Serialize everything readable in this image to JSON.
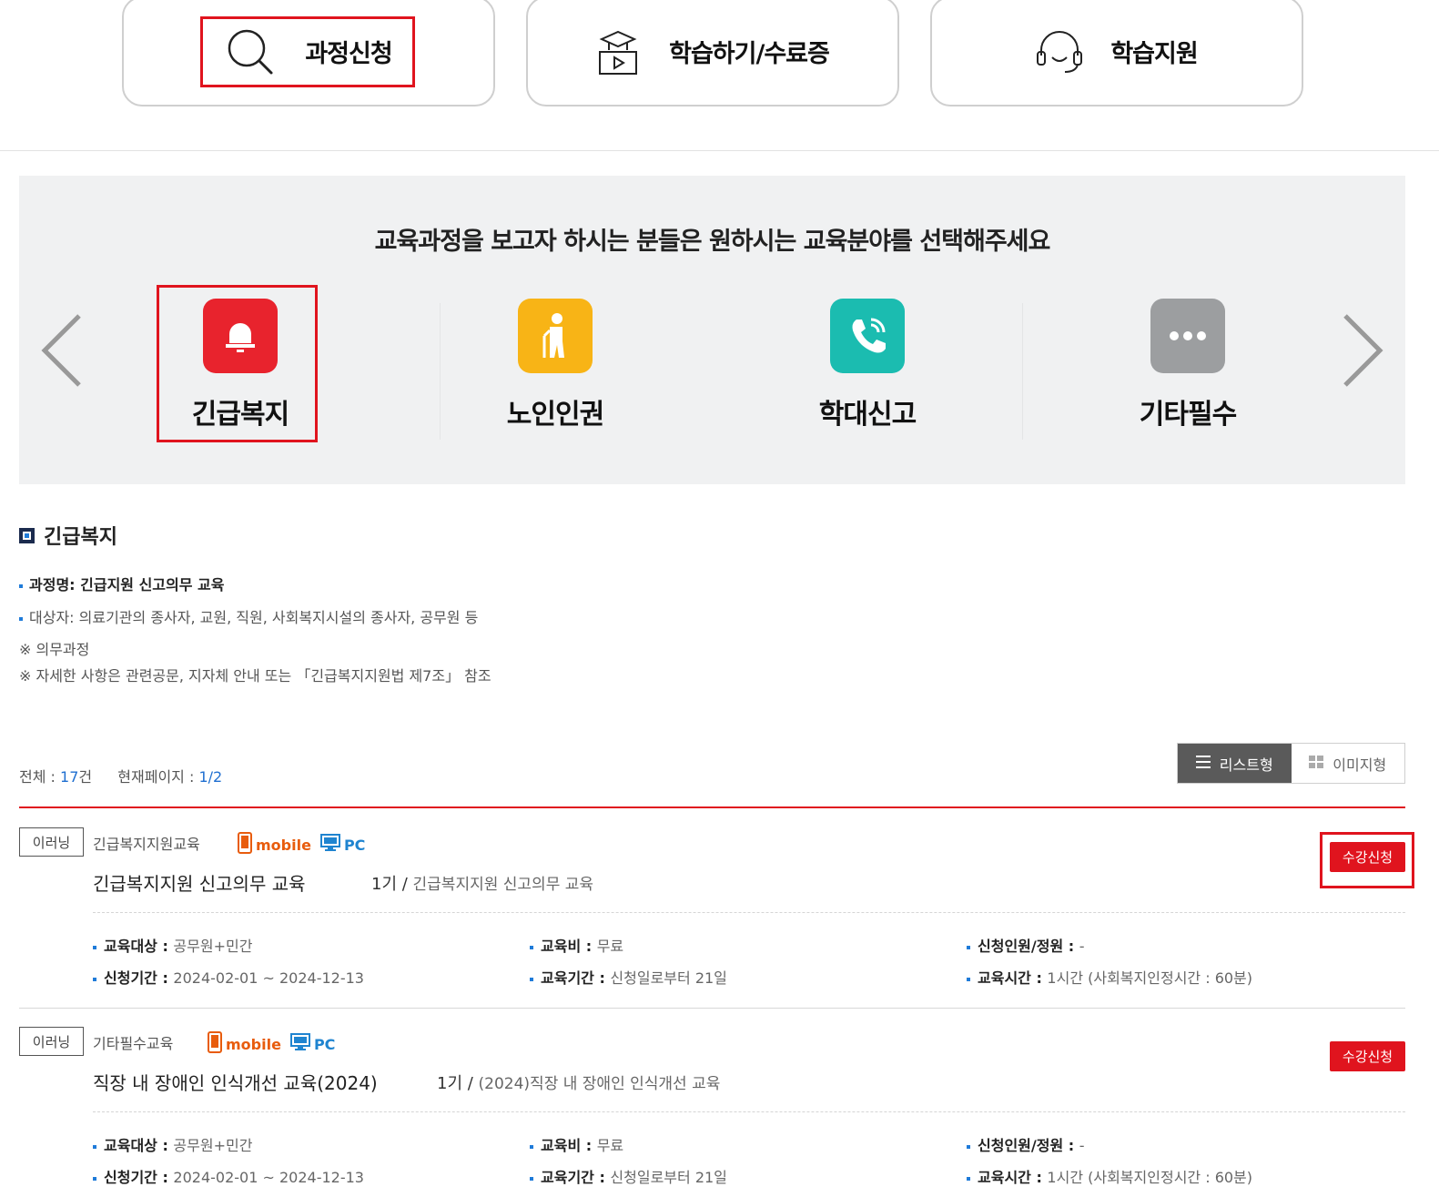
{
  "nav": {
    "items": [
      {
        "label": "과정신청",
        "icon": "search-icon"
      },
      {
        "label": "학습하기/수료증",
        "icon": "study-icon"
      },
      {
        "label": "학습지원",
        "icon": "headset-icon"
      }
    ]
  },
  "category_panel": {
    "title": "교육과정을 보고자 하시는 분들은 원하시는 교육분야를 선택해주세요",
    "items": [
      {
        "label": "긴급복지",
        "icon": "bell-icon",
        "color": "#e8232d"
      },
      {
        "label": "노인인권",
        "icon": "elderly-icon",
        "color": "#f8b416"
      },
      {
        "label": "학대신고",
        "icon": "phone-icon",
        "color": "#1bbcb0"
      },
      {
        "label": "기타필수",
        "icon": "more-icon",
        "color": "#9c9ea0"
      }
    ]
  },
  "section": {
    "title": "긴급복지",
    "course_name": "과정명: 긴급지원 신고의무 교육",
    "target": "대상자: 의료기관의 종사자, 교원, 직원, 사회복지시설의 종사자, 공무원 등",
    "note1": "※ 의무과정",
    "note2": "※ 자세한 사항은 관련공문, 지자체 안내 또는 「긴급복지지원법 제7조」 참조"
  },
  "list_info": {
    "total_label": "전체 : ",
    "total_value": "17",
    "total_unit": "건",
    "page_label": "현재페이지 : ",
    "page_value": "1/2"
  },
  "view_toggle": {
    "list_label": "리스트형",
    "image_label": "이미지형"
  },
  "courses": [
    {
      "tag": "이러닝",
      "category": "긴급복지지원교육",
      "mobile": "mobile",
      "pc": "PC",
      "title": "긴급복지지원 신고의무 교육",
      "term": "1기",
      "term_sep": " / ",
      "term_name": "긴급복지지원 신고의무 교육",
      "apply": "수강신청",
      "target_label": "교육대상 : ",
      "target_value": "공무원+민간",
      "fee_label": "교육비 : ",
      "fee_value": "무료",
      "capacity_label": "신청인원/정원 : ",
      "capacity_value": "-",
      "apply_period_label": "신청기간 : ",
      "apply_period_value": "2024-02-01 ~ 2024-12-13",
      "edu_period_label": "교육기간 : ",
      "edu_period_value": "신청일로부터 21일",
      "edu_time_label": "교육시간 : ",
      "edu_time_value": "1시간 (사회복지인정시간 : 60분)"
    },
    {
      "tag": "이러닝",
      "category": "기타필수교육",
      "mobile": "mobile",
      "pc": "PC",
      "title": "직장 내 장애인 인식개선 교육(2024)",
      "term": "1기",
      "term_sep": " / ",
      "term_name": "(2024)직장 내 장애인 인식개선 교육",
      "apply": "수강신청",
      "target_label": "교육대상 : ",
      "target_value": "공무원+민간",
      "fee_label": "교육비 : ",
      "fee_value": "무료",
      "capacity_label": "신청인원/정원 : ",
      "capacity_value": "-",
      "apply_period_label": "신청기간 : ",
      "apply_period_value": "2024-02-01 ~ 2024-12-13",
      "edu_period_label": "교육기간 : ",
      "edu_period_value": "신청일로부터 21일",
      "edu_time_label": "교육시간 : ",
      "edu_time_value": "1시간 (사회복지인정시간 : 60분)"
    }
  ],
  "colors": {
    "accent_red": "#e0141e",
    "accent_blue": "#1f7bd9",
    "panel_bg": "#f0f1f2"
  }
}
